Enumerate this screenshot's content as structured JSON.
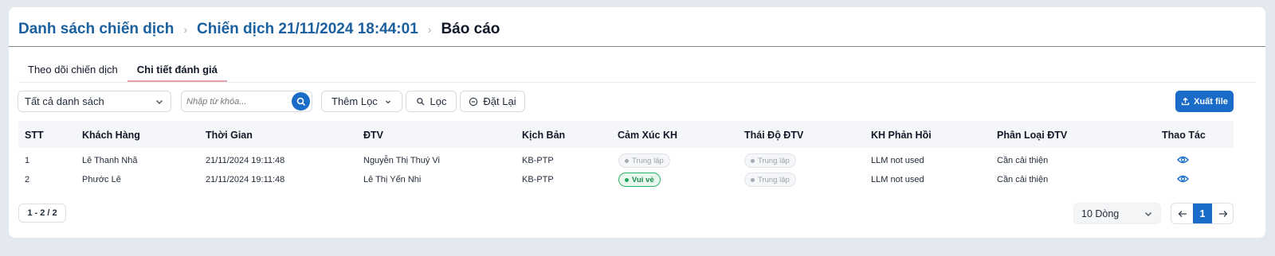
{
  "breadcrumb": {
    "items": [
      "Danh sách chiến dịch",
      "Chiến dịch 21/11/2024 18:44:01"
    ],
    "current": "Báo cáo",
    "separator": "›"
  },
  "tabs": [
    {
      "label": "Theo dõi chiến dịch",
      "active": false
    },
    {
      "label": "Chi tiết đánh giá",
      "active": true
    }
  ],
  "filters": {
    "list_select": "Tất cả danh sách",
    "search_placeholder": "Nhập từ khóa...",
    "more_filter": "Thêm Lọc",
    "filter_button": "Lọc",
    "reset_button": "Đặt Lại",
    "export_button": "Xuất file"
  },
  "table": {
    "headers": [
      "STT",
      "Khách Hàng",
      "Thời Gian",
      "ĐTV",
      "Kịch Bản",
      "Cảm Xúc KH",
      "Thái Độ ĐTV",
      "KH Phản Hồi",
      "Phân Loại ĐTV",
      "Thao Tác"
    ],
    "rows": [
      {
        "stt": "1",
        "customer": "Lê Thanh Nhã",
        "time": "21/11/2024 19:11:48",
        "agent": "Nguyễn Thị Thuý Vi",
        "script": "KB-PTP",
        "emotion": "Trung lập",
        "emotion_type": "neutral",
        "attitude": "Trung lập",
        "feedback": "LLM not used",
        "classification": "Cần cải thiện"
      },
      {
        "stt": "2",
        "customer": "Phước Lê",
        "time": "21/11/2024 19:11:48",
        "agent": "Lê Thị Yến Nhi",
        "script": "KB-PTP",
        "emotion": "Vui vẻ",
        "emotion_type": "happy",
        "attitude": "Trung lập",
        "feedback": "LLM not used",
        "classification": "Cần cải thiện"
      }
    ]
  },
  "pagination": {
    "count": "1 - 2 / 2",
    "page_size": "10 Dòng",
    "current_page": "1"
  },
  "colors": {
    "primary": "#1a6cc8",
    "breadcrumb_link": "#1a5f9e",
    "happy": "#21a85a",
    "background": "#e4e9f0"
  },
  "icons": {
    "search": "search-icon",
    "chevron": "chevron-down-icon",
    "filter": "filter-search-icon",
    "reset": "minus-circle-icon",
    "export": "upload-icon",
    "view": "eye-icon",
    "prev": "arrow-left-icon",
    "next": "arrow-right-icon"
  }
}
